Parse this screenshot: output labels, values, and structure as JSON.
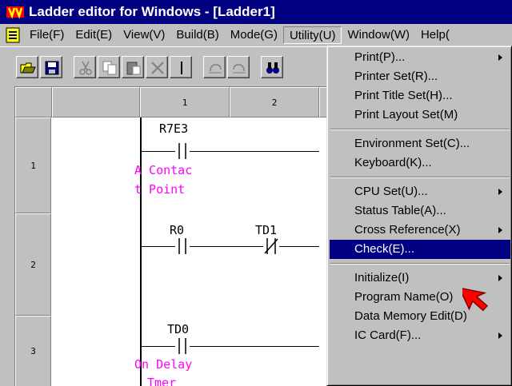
{
  "window": {
    "title": "Ladder editor for Windows - [Ladder1]"
  },
  "menubar": {
    "items": [
      {
        "label": "File(F)",
        "name": "menu-file"
      },
      {
        "label": "Edit(E)",
        "name": "menu-edit"
      },
      {
        "label": "View(V)",
        "name": "menu-view"
      },
      {
        "label": "Build(B)",
        "name": "menu-build"
      },
      {
        "label": "Mode(G)",
        "name": "menu-mode"
      },
      {
        "label": "Utility(U)",
        "name": "menu-utility"
      },
      {
        "label": "Window(W)",
        "name": "menu-window"
      },
      {
        "label": "Help(",
        "name": "menu-help"
      }
    ]
  },
  "toolbar": {
    "buttons": [
      "open-icon",
      "save-icon",
      "cut-icon",
      "copy-icon",
      "paste-icon",
      "delete-icon",
      "vertical-line-icon",
      "undo-icon",
      "redo-icon",
      "find-icon"
    ]
  },
  "grid": {
    "columns": [
      "1",
      "2"
    ],
    "rows": [
      "1",
      "2",
      "3"
    ]
  },
  "ladder": {
    "r7e3": {
      "device": "R7E3",
      "comment1": "A Contac",
      "comment2": "t Point"
    },
    "r0": {
      "device": "R0"
    },
    "td1": {
      "device": "TD1"
    },
    "td0": {
      "device": "TD0",
      "comment1": "On Delay",
      "comment2": "Tmer"
    }
  },
  "utility_menu": {
    "items": [
      {
        "label": "Print(P)...",
        "submenu": true
      },
      {
        "label": "Printer Set(R)...",
        "submenu": false
      },
      {
        "label": "Print Title Set(H)...",
        "submenu": false
      },
      {
        "label": "Print Layout Set(M)",
        "submenu": false
      },
      {
        "label": "Environment Set(C)...",
        "submenu": false
      },
      {
        "label": "Keyboard(K)...",
        "submenu": false
      },
      {
        "label": "CPU Set(U)...",
        "submenu": true
      },
      {
        "label": "Status Table(A)...",
        "submenu": false
      },
      {
        "label": "Cross Reference(X)",
        "submenu": true
      },
      {
        "label": "Check(E)...",
        "submenu": false,
        "highlighted": true
      },
      {
        "label": "Initialize(I)",
        "submenu": true
      },
      {
        "label": "Program Name(O)",
        "submenu": false
      },
      {
        "label": "Data Memory Edit(D)",
        "submenu": false
      },
      {
        "label": "IC Card(F)...",
        "submenu": true
      }
    ]
  },
  "colors": {
    "title_bg": "#000080",
    "highlight": "#000080",
    "comment": "#ff00ff",
    "cursor": "#ff0000"
  }
}
